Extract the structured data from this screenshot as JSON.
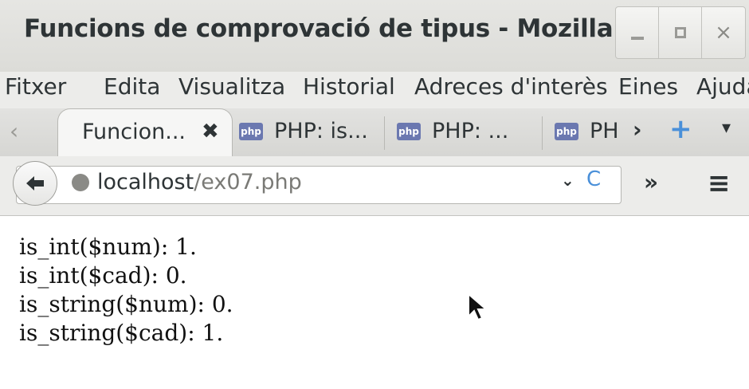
{
  "window": {
    "title": "Funcions de comprovació de tipus - Mozilla Firefo",
    "controls": {
      "minimize": "minimize",
      "maximize": "maximize",
      "close": "×"
    }
  },
  "menubar": {
    "items": [
      "Fitxer",
      "Edita",
      "Visualitza",
      "Historial",
      "Adreces d'interès",
      "Eines",
      "Ajuda"
    ]
  },
  "tabs": {
    "active": {
      "label": "Funcion...",
      "close": "✖"
    },
    "others": [
      {
        "icon": "php",
        "label": "PHP: is..."
      },
      {
        "icon": "php",
        "label": "PHP: ..."
      },
      {
        "icon": "php",
        "label": "PH"
      }
    ],
    "scroll_left": "‹",
    "scroll_right": "›",
    "new_tab": "+",
    "all_tabs": "▾"
  },
  "navbar": {
    "url_host": "localhost",
    "url_path": "/ex07.php",
    "dropdown": "⌄",
    "reload": "C",
    "overflow": "»",
    "menu": "≡"
  },
  "content": {
    "lines": [
      "is_int($num): 1.",
      "is_int($cad): 0.",
      "is_string($num): 0.",
      "is_string($cad): 1."
    ]
  },
  "icons": {
    "globe": "globe-icon",
    "back": "back-arrow-icon",
    "php": "php-icon",
    "cursor": "mouse-pointer-icon"
  }
}
